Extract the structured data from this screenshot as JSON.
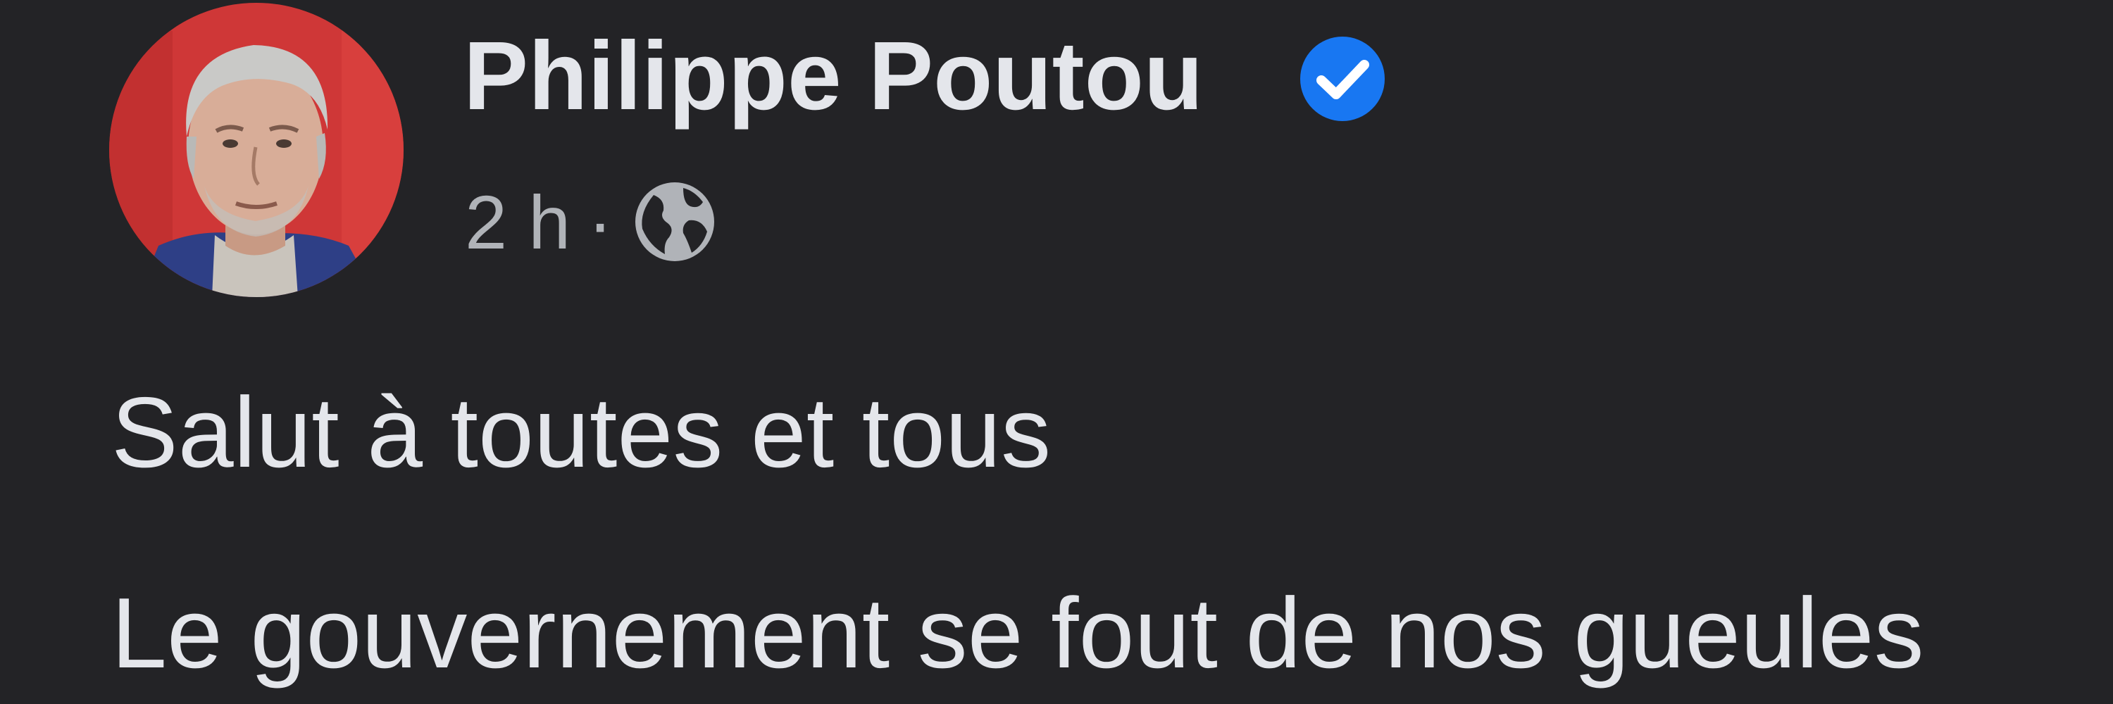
{
  "post": {
    "author": {
      "name": "Philippe Poutou",
      "avatar_icon": "profile-photo",
      "verified": true,
      "verified_icon": "verified-badge-icon"
    },
    "timestamp": "2 h",
    "separator": "·",
    "audience_icon": "globe-icon",
    "body_lines": [
      "Salut à toutes et tous",
      "Le gouvernement se fout de nos gueules"
    ]
  },
  "colors": {
    "background": "#232326",
    "primary_text": "#e4e6eb",
    "secondary_text": "#b0b3b8",
    "verified_blue": "#1877f2",
    "avatar_background": "#d63b3b"
  }
}
